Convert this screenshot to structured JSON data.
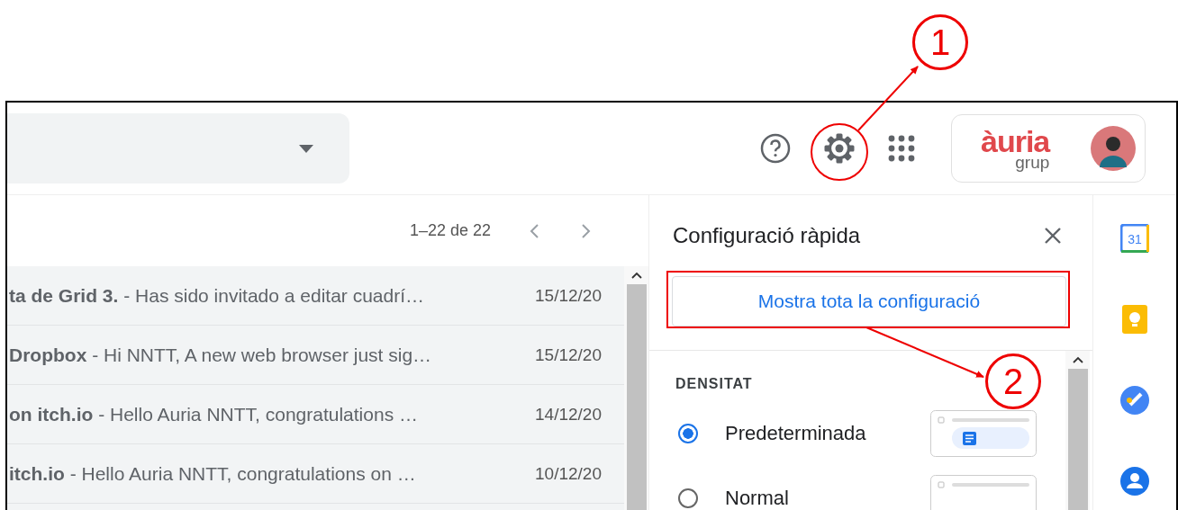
{
  "header": {
    "account": {
      "logo_main": "àuria",
      "logo_sub": "grup"
    }
  },
  "pagination": {
    "range": "1–22 de 22"
  },
  "emails": [
    {
      "text": "**ta de Grid 3.** - Has sido invitado a editar cuadrí…",
      "date": "15/12/20"
    },
    {
      "text": "**Dropbox** - Hi NNTT, A new web browser just sig…",
      "date": "15/12/20"
    },
    {
      "text": "**on itch.io** - Hello Auria NNTT, congratulations …",
      "date": "14/12/20"
    },
    {
      "text": "**itch.io** - Hello Auria NNTT, congratulations on …",
      "date": "10/12/20"
    }
  ],
  "quick_settings": {
    "title": "Configuració ràpida",
    "all_settings_button": "Mostra tota la configuració",
    "section": "DENSITAT",
    "options": [
      {
        "label": "Predeterminada",
        "selected": true
      },
      {
        "label": "Normal",
        "selected": false
      }
    ]
  },
  "calendar_icon_text": "31",
  "annotations": [
    {
      "label": "1"
    },
    {
      "label": "2"
    }
  ]
}
